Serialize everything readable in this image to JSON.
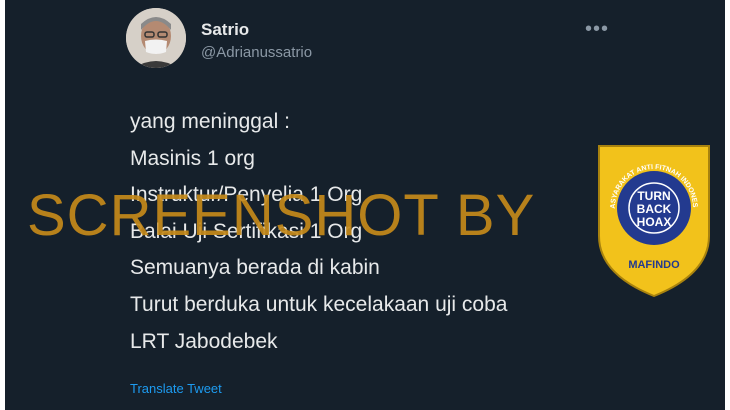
{
  "tweet": {
    "author_name": "Satrio",
    "author_handle": "@Adrianussatrio",
    "more_glyph": "•••",
    "lines": [
      "yang meninggal :",
      "Masinis 1 org",
      "Instruktur/Penyelia 1 Org",
      "Balai Uji Sertifikasi 1 Org",
      "Semuanya berada di kabin",
      "Turut berduka untuk kecelakaan uji coba",
      "LRT Jabodebek"
    ],
    "translate_label": "Translate Tweet"
  },
  "watermark": {
    "text": "SCREENSHOT BY"
  },
  "badge": {
    "arc_text": "MASYARAKAT ANTI FITNAH INDONESIA",
    "logo_line1": "TURN",
    "logo_line2": "BACK",
    "logo_line3": "HOAX",
    "org_name": "MAFINDO",
    "colors": {
      "shield": "#f2c21b",
      "inner": "#233a8f",
      "text": "#ffffff"
    }
  },
  "colors": {
    "background": "#15202b",
    "text": "#e7e9ea",
    "muted": "#8b98a5",
    "link": "#1d9bf0",
    "watermark": "#c58a1a"
  }
}
